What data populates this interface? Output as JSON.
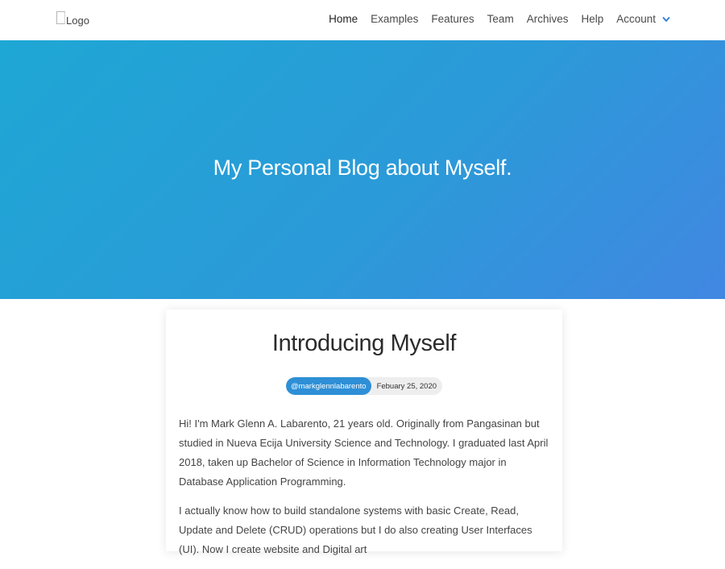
{
  "navbar": {
    "logo_text": "Logo",
    "links": [
      {
        "label": "Home"
      },
      {
        "label": "Examples"
      },
      {
        "label": "Features"
      },
      {
        "label": "Team"
      },
      {
        "label": "Archives"
      },
      {
        "label": "Help"
      }
    ],
    "account_label": "Account",
    "account_icon": "chevron-down-icon"
  },
  "hero": {
    "title": "My Personal Blog about Myself."
  },
  "post": {
    "title": "Introducing Myself",
    "author": "@markglennlabarento",
    "date": "Febuary 25, 2020",
    "paragraphs": [
      "Hi! I'm Mark Glenn A. Labarento, 21 years old. Originally from Pangasinan but studied in Nueva Ecija University Science and Technology. I graduated last April 2018, taken up Bachelor of Science in Information Technology major in Database Application Programming.",
      "I actually know how to build standalone systems with basic Create, Read, Update and Delete (CRUD) operations but I do also creating User Interfaces (UI). Now I create website and Digital art"
    ]
  },
  "colors": {
    "hero_gradient_start": "#1ea7d4",
    "hero_gradient_end": "#4187e2",
    "author_badge": "#2e8fd6",
    "chevron": "#2e7bd6"
  }
}
